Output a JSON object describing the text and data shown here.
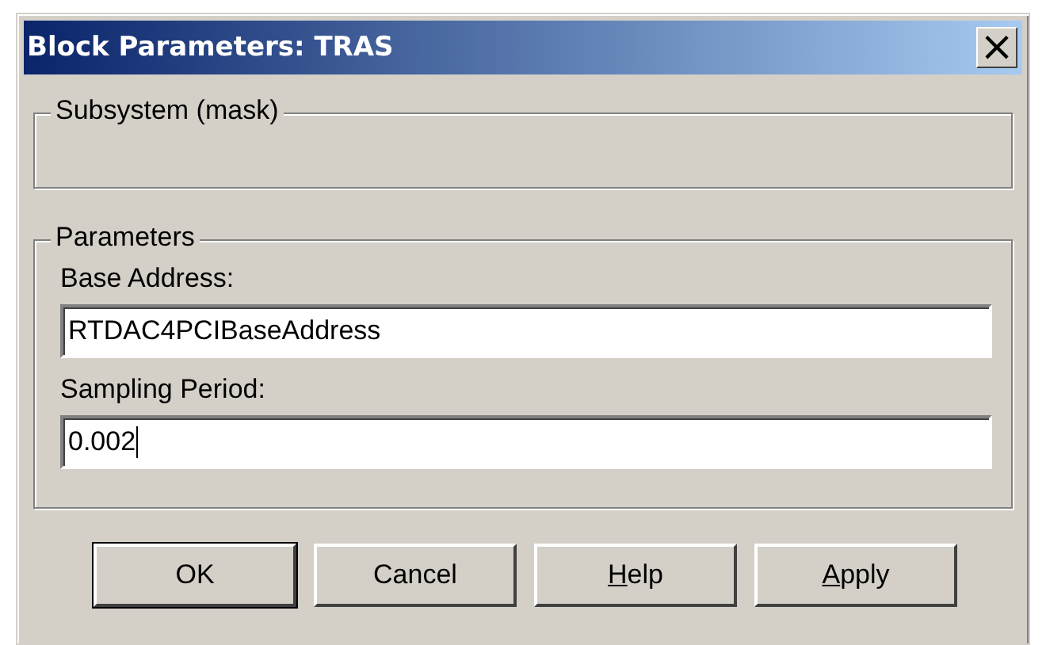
{
  "window": {
    "title": "Block Parameters: TRAS",
    "close": "×"
  },
  "description_group": {
    "title": "Subsystem (mask)"
  },
  "parameters_group": {
    "title": "Parameters",
    "fields": [
      {
        "label": "Base Address:",
        "value": "RTDAC4PCIBaseAddress",
        "focused": false
      },
      {
        "label": "Sampling Period:",
        "value": "0.002",
        "focused": true
      }
    ]
  },
  "buttons": [
    {
      "label": "OK",
      "default": true,
      "underline_first": false
    },
    {
      "label": "Cancel",
      "default": false,
      "underline_first": false
    },
    {
      "label": "Help",
      "default": false,
      "underline_first": true
    },
    {
      "label": "Apply",
      "default": false,
      "underline_first": true
    }
  ]
}
